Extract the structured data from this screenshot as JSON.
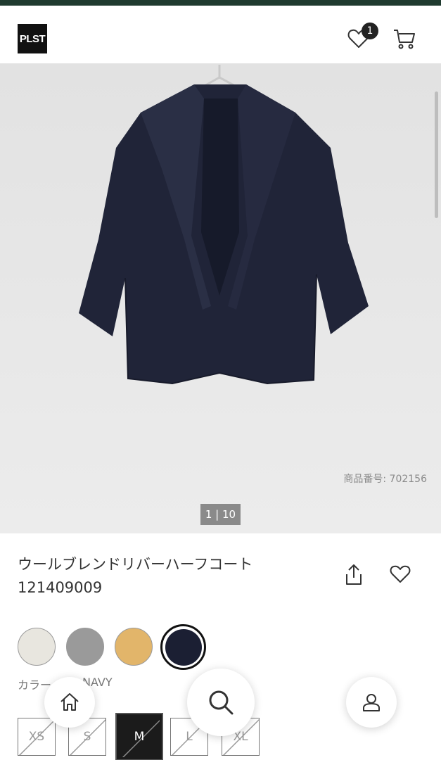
{
  "header": {
    "logo_text": "PLST",
    "favorites_count": "1",
    "colors": {
      "strip": "#1f3a2f",
      "logo_bg": "#111111"
    }
  },
  "gallery": {
    "item_number": "商品番号: 702156",
    "pager": "1 | 10",
    "background": "#e8e8e8"
  },
  "product": {
    "name": "ウールブレンドリバーハーフコート",
    "code": "121409009"
  },
  "colors": {
    "label": "カラー",
    "selected_value": "NAVY",
    "swatches": [
      {
        "name": "off-white",
        "hex": "#e8e6df",
        "selected": false
      },
      {
        "name": "gray",
        "hex": "#9a9a9a",
        "selected": false
      },
      {
        "name": "camel",
        "hex": "#e2b56a",
        "selected": false
      },
      {
        "name": "navy",
        "hex": "#1b1f33",
        "selected": true
      }
    ]
  },
  "sizes": [
    {
      "label": "XS",
      "available": false,
      "selected": false
    },
    {
      "label": "S",
      "available": false,
      "selected": false
    },
    {
      "label": "M",
      "available": false,
      "selected": true
    },
    {
      "label": "L",
      "available": false,
      "selected": false
    },
    {
      "label": "XL",
      "available": false,
      "selected": false
    }
  ],
  "nav": {
    "icons": [
      "home-icon",
      "search-icon",
      "account-icon"
    ]
  }
}
